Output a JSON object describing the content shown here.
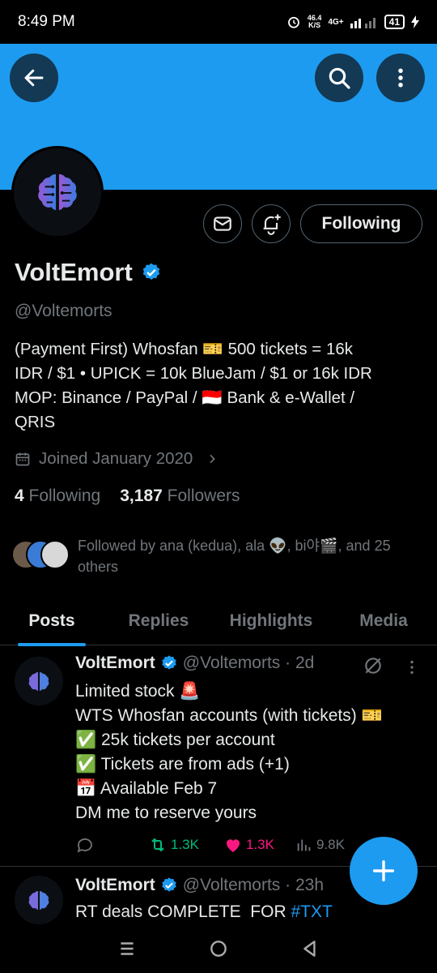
{
  "status_bar": {
    "time": "8:49 PM",
    "net_speed_value": "46.4",
    "net_speed_unit": "K/S",
    "network": "4G+",
    "battery": "41"
  },
  "colors": {
    "accent": "#1d9bf0",
    "background": "#000000",
    "text_primary": "#e7e9ea",
    "text_secondary": "#71767b",
    "retweet": "#00ba7c",
    "like": "#f91880"
  },
  "profile": {
    "name": "VoltEmort",
    "handle": "@Voltemorts",
    "bio_lines": [
      "(Payment First) Whosfan 🎫 500 tickets = 16k",
      "IDR / $1 • UPICK = 10k BlueJam / $1 or 16k IDR",
      "MOP: Binance / PayPal / 🇮🇩 Bank & e-Wallet /",
      "QRIS"
    ],
    "joined": "Joined January 2020",
    "following_count": "4",
    "following_label": "Following",
    "followers_count": "3,187",
    "followers_label": "Followers",
    "followed_by": "Followed by ana (kedua), ala 👽, bi야🎬, and 25 others",
    "follow_button_label": "Following"
  },
  "tabs": [
    {
      "label": "Posts",
      "active": true
    },
    {
      "label": "Replies",
      "active": false
    },
    {
      "label": "Highlights",
      "active": false
    },
    {
      "label": "Media",
      "active": false
    }
  ],
  "posts": [
    {
      "name": "VoltEmort",
      "meta": "@Voltemorts · 2d",
      "lines": [
        "Limited stock 🚨",
        "WTS Whosfan accounts (with tickets) 🎫",
        "✅ 25k tickets per account",
        "✅ Tickets are from ads (+1)",
        "📅 Available Feb 7",
        "DM me to reserve yours"
      ],
      "retweets": "1.3K",
      "likes": "1.3K",
      "views": "9.8K"
    },
    {
      "name": "VoltEmort",
      "meta": "@Voltemorts · 23h",
      "text_prefix": "RT deals COMPLETE  FOR ",
      "hashtag": "#TXT"
    }
  ],
  "icons": {
    "back": "arrow-left-icon",
    "search": "search-icon",
    "more": "more-vertical-icon",
    "message": "envelope-icon",
    "notify": "bell-plus-icon",
    "verified": "verified-badge-icon",
    "calendar": "calendar-icon",
    "reply": "reply-icon",
    "retweet": "retweet-icon",
    "like": "heart-icon",
    "views": "views-icon",
    "compose": "plus-icon"
  }
}
